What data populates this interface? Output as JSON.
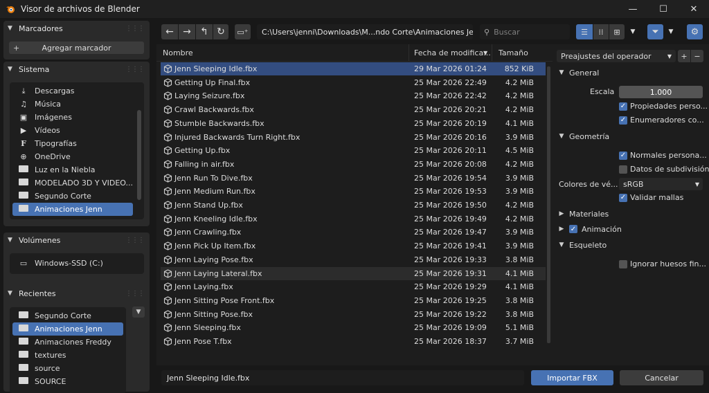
{
  "window": {
    "title": "Visor de archivos de Blender",
    "minimize": "—",
    "maximize": "☐",
    "close": "✕"
  },
  "sidebar": {
    "bookmarks": {
      "title": "Marcadores",
      "add_label": "Agregar marcador"
    },
    "system": {
      "title": "Sistema",
      "items": [
        {
          "label": "Descargas",
          "icon": "download-icon"
        },
        {
          "label": "Música",
          "icon": "music-icon"
        },
        {
          "label": "Imágenes",
          "icon": "image-icon"
        },
        {
          "label": "Vídeos",
          "icon": "video-icon"
        },
        {
          "label": "Tipografías",
          "icon": "font-icon"
        },
        {
          "label": "OneDrive",
          "icon": "globe-icon"
        },
        {
          "label": "Luz en la Niebla",
          "icon": "folder-icon"
        },
        {
          "label": "MODELADO 3D Y VIDEO...",
          "icon": "folder-icon"
        },
        {
          "label": "Segundo Corte",
          "icon": "folder-icon"
        },
        {
          "label": "Animaciones Jenn",
          "icon": "folder-icon",
          "selected": true
        }
      ]
    },
    "volumes": {
      "title": "Volúmenes",
      "items": [
        {
          "label": "Windows-SSD (C:)",
          "icon": "disk-icon"
        }
      ]
    },
    "recents": {
      "title": "Recientes",
      "items": [
        {
          "label": "Segundo Corte"
        },
        {
          "label": "Animaciones Jenn",
          "selected": true
        },
        {
          "label": "Animaciones Freddy"
        },
        {
          "label": "textures"
        },
        {
          "label": "source"
        },
        {
          "label": "SOURCE"
        }
      ]
    }
  },
  "toolbar": {
    "path": "C:\\Users\\jenni\\Downloads\\M...ndo Corte\\Animaciones Jenn\\",
    "search_placeholder": "Buscar"
  },
  "filelist": {
    "columns": {
      "name": "Nombre",
      "date": "Fecha de modifica...",
      "size": "Tamaño"
    },
    "rows": [
      {
        "name": "Jenn Sleeping Idle.fbx",
        "date": "29 Mar 2026 01:24",
        "size": "852 KiB",
        "selected": true
      },
      {
        "name": "Getting Up Final.fbx",
        "date": "25 Mar 2026 22:49",
        "size": "4.2 MiB"
      },
      {
        "name": "Laying Seizure.fbx",
        "date": "25 Mar 2026 22:42",
        "size": "4.2 MiB"
      },
      {
        "name": "Crawl Backwards.fbx",
        "date": "25 Mar 2026 20:21",
        "size": "4.2 MiB"
      },
      {
        "name": "Stumble Backwards.fbx",
        "date": "25 Mar 2026 20:19",
        "size": "4.1 MiB"
      },
      {
        "name": "Injured Backwards Turn Right.fbx",
        "date": "25 Mar 2026 20:16",
        "size": "3.9 MiB"
      },
      {
        "name": "Getting Up.fbx",
        "date": "25 Mar 2026 20:11",
        "size": "4.5 MiB"
      },
      {
        "name": "Falling in air.fbx",
        "date": "25 Mar 2026 20:08",
        "size": "4.2 MiB"
      },
      {
        "name": "Jenn Run To Dive.fbx",
        "date": "25 Mar 2026 19:54",
        "size": "3.9 MiB"
      },
      {
        "name": "Jenn Medium Run.fbx",
        "date": "25 Mar 2026 19:53",
        "size": "3.9 MiB"
      },
      {
        "name": "Jenn Stand Up.fbx",
        "date": "25 Mar 2026 19:50",
        "size": "4.2 MiB"
      },
      {
        "name": "Jenn Kneeling Idle.fbx",
        "date": "25 Mar 2026 19:49",
        "size": "4.2 MiB"
      },
      {
        "name": "Jenn Crawling.fbx",
        "date": "25 Mar 2026 19:47",
        "size": "3.9 MiB"
      },
      {
        "name": "Jenn Pick Up Item.fbx",
        "date": "25 Mar 2026 19:41",
        "size": "3.9 MiB"
      },
      {
        "name": "Jenn Laying Pose.fbx",
        "date": "25 Mar 2026 19:33",
        "size": "3.8 MiB"
      },
      {
        "name": "Jenn Laying Lateral.fbx",
        "date": "25 Mar 2026 19:31",
        "size": "4.1 MiB",
        "hover": true
      },
      {
        "name": "Jenn Laying.fbx",
        "date": "25 Mar 2026 19:29",
        "size": "4.1 MiB"
      },
      {
        "name": "Jenn Sitting Pose Front.fbx",
        "date": "25 Mar 2026 19:25",
        "size": "3.8 MiB"
      },
      {
        "name": "Jenn Sitting Pose.fbx",
        "date": "25 Mar 2026 19:22",
        "size": "3.8 MiB"
      },
      {
        "name": "Jenn Sleeping.fbx",
        "date": "25 Mar 2026 19:09",
        "size": "5.1 MiB"
      },
      {
        "name": "Jenn Pose T.fbx",
        "date": "25 Mar 2026 18:37",
        "size": "3.7 MiB"
      }
    ]
  },
  "options": {
    "preset_label": "Preajustes del operador",
    "general": {
      "title": "General",
      "scale_label": "Escala",
      "scale_value": "1.000",
      "custom_props": "Propiedades perso...",
      "enum_as_strings": "Enumeradores co..."
    },
    "geometry": {
      "title": "Geometría",
      "custom_normals": "Normales persona...",
      "subdivision": "Datos de subdivisión",
      "vertex_colors_label": "Colores de vé...",
      "vertex_colors_value": "sRGB",
      "validate_meshes": "Validar mallas"
    },
    "materials": {
      "title": "Materiales"
    },
    "animation": {
      "title": "Animación"
    },
    "armature": {
      "title": "Esqueleto",
      "ignore_leaf": "Ignorar huesos fin..."
    }
  },
  "bottom": {
    "filename": "Jenn Sleeping Idle.fbx",
    "import_label": "Importar FBX",
    "cancel_label": "Cancelar"
  },
  "colors": {
    "accent": "#4772b3",
    "selection": "#334d80",
    "background": "#181818"
  }
}
